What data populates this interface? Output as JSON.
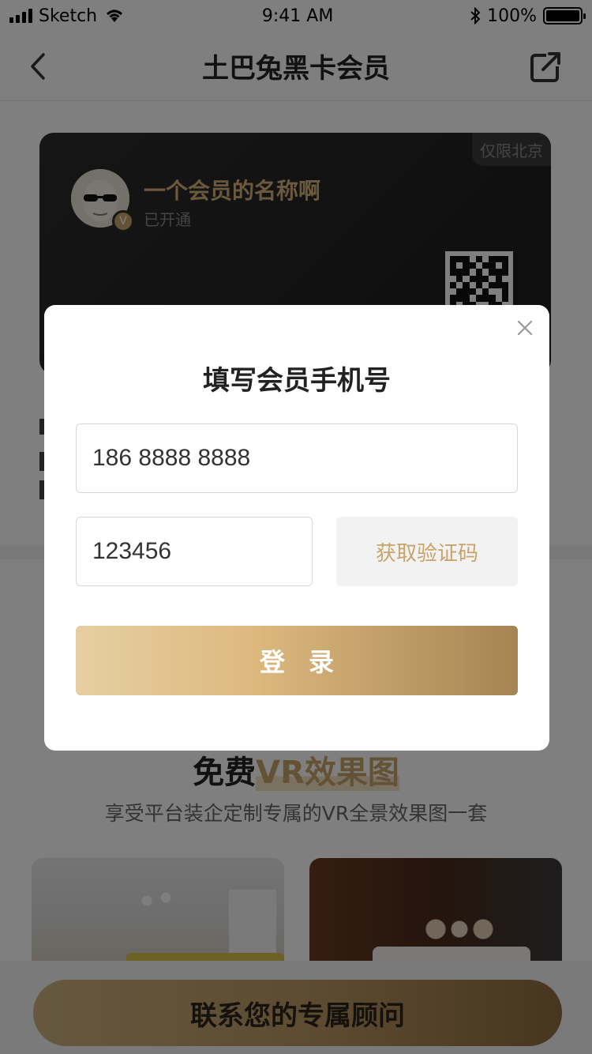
{
  "status_bar": {
    "carrier": "Sketch",
    "time": "9:41 AM",
    "battery_percent": "100%"
  },
  "nav": {
    "title": "土巴兔黑卡会员",
    "back_icon": "chevron-left-icon",
    "share_icon": "share-icon"
  },
  "card": {
    "tag": "仅限北京",
    "member_name": "一个会员的名称啊",
    "member_status": "已开通",
    "badge_text": "V"
  },
  "promo": {
    "title_prefix": "免费",
    "title_highlight": "VR效果图",
    "subtitle": "享受平台装企定制专属的VR全景效果图一套"
  },
  "bottom": {
    "contact_button": "联系您的专属顾问"
  },
  "modal": {
    "title": "填写会员手机号",
    "phone_value": "186 8888 8888",
    "code_value": "123456",
    "get_code_button": "获取验证码",
    "login_button": "登录"
  },
  "colors": {
    "gold_accent": "#c9a46a",
    "card_dark": "#2c2c2e",
    "overlay": "rgba(0,0,0,0.5)"
  }
}
